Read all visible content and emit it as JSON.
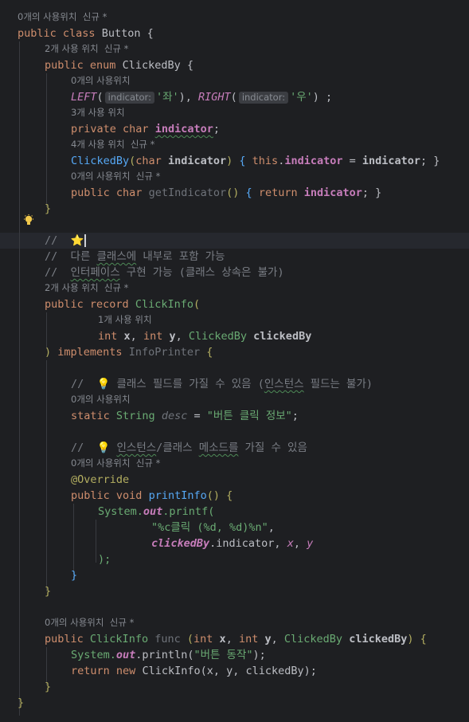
{
  "colors": {
    "background": "#1e1f22",
    "keyword": "#cf8e6d",
    "string": "#6aab73",
    "method": "#56a8f5",
    "field": "#c77dbb",
    "comment": "#7a7e85",
    "annotation": "#b3ae60"
  },
  "icons": {
    "intention_bulb": "lightbulb-icon"
  },
  "code": {
    "l1_hint": "0개의 사용위치  신규 *",
    "l2": {
      "public": "public",
      "class": "class",
      "name": "Button",
      "brace": "{"
    },
    "l3_hint": "2개 사용 위치  신규 *",
    "l4": {
      "public": "public",
      "enum": "enum",
      "name": "ClickedBy",
      "brace": "{"
    },
    "l5_hint": "0개의 사용위치",
    "l6": {
      "left": "LEFT",
      "inlay1": "indicator:",
      "val1": "'좌'",
      "right": "RIGHT",
      "inlay2": "indicator:",
      "val2": "'우'",
      "end": ") ;"
    },
    "l7_hint": "3개 사용 위치",
    "l8": {
      "private": "private",
      "char": "char",
      "field": "indicator",
      "semi": ";"
    },
    "l9_hint": "4개 사용 위치  신규 *",
    "l10": {
      "ctor": "ClickedBy",
      "char": "char",
      "param": "indicator",
      "this": "this",
      "field": "indicator",
      "eq": " = ",
      "param2": "indicator",
      "end": "; }"
    },
    "l11_hint": "0개의 사용위치  신규 *",
    "l12": {
      "public": "public",
      "char": "char",
      "method": "getIndicator",
      "ret": "return",
      "field": "indicator",
      "end": "; }"
    },
    "l13": "}",
    "l15": {
      "slashes": "//",
      "emoji": "⭐"
    },
    "l16": {
      "slashes": "//",
      "text1": "다른 ",
      "wavy": "클래스에",
      "text2": " 내부로 포함 가능"
    },
    "l17": {
      "slashes": "//",
      "wavy": "인터페이스",
      "text": " 구현 가능 (클래스 상속은 불가)"
    },
    "l18_hint": "2개 사용 위치  신규 *",
    "l19": {
      "public": "public",
      "record": "record",
      "name": "ClickInfo",
      "paren": "("
    },
    "l20_hint": "1개 사용 위치",
    "l21": {
      "int1": "int",
      "x": "x",
      "int2": "int",
      "y": "y",
      "type": "ClickedBy",
      "param": "clickedBy"
    },
    "l22": {
      "paren": ")",
      "implements": "implements",
      "iface": "InfoPrinter",
      "brace": "{"
    },
    "l24": {
      "slashes": "//",
      "emoji": "💡",
      "text1": " 클래스 필드를 가질 수 있음 (",
      "wavy": "인스턴스",
      "text2": " 필드는 불가)"
    },
    "l25_hint": "0개의 사용위치",
    "l26": {
      "static": "static",
      "type": "String",
      "field": "desc",
      "eq": " = ",
      "str": "\"버튼 클릭 정보\"",
      "semi": ";"
    },
    "l28": {
      "slashes": "//",
      "emoji": "💡",
      "wavy1": "인스턴스",
      "text1": "/클래스 ",
      "wavy2": "메소드를",
      "text2": " 가질 수 있음"
    },
    "l29_hint": "0개의 사용위치  신규 *",
    "l30": "@Override",
    "l31": {
      "public": "public",
      "void": "void",
      "method": "printInfo",
      "end": "() {"
    },
    "l32": {
      "system": "System.",
      "out": "out",
      "printf": ".printf("
    },
    "l33": {
      "str": "\"%c클릭 (%d, %d)%n\"",
      "comma": ","
    },
    "l34": {
      "cb": "clickedBy",
      "dot": ".indicator, ",
      "x": "x",
      "comma": ", ",
      "y": "y"
    },
    "l35": ");",
    "l36": "}",
    "l37": "}",
    "l39_hint": "0개의 사용위치  신규 *",
    "l40": {
      "public": "public",
      "name": "ClickInfo",
      "func": "func",
      "int1": "int",
      "x": "x",
      "int2": "int",
      "y": "y",
      "type": "ClickedBy",
      "param": "clickedBy",
      "end": ") {"
    },
    "l41": {
      "system": "System.",
      "out": "out",
      "println": ".println(",
      "str": "\"버튼 동작\"",
      "end": ");"
    },
    "l42": {
      "ret": "return",
      "new": "new",
      "name": "ClickInfo",
      "args": "(x, y, clickedBy);"
    },
    "l43": "}",
    "l44": "}"
  }
}
